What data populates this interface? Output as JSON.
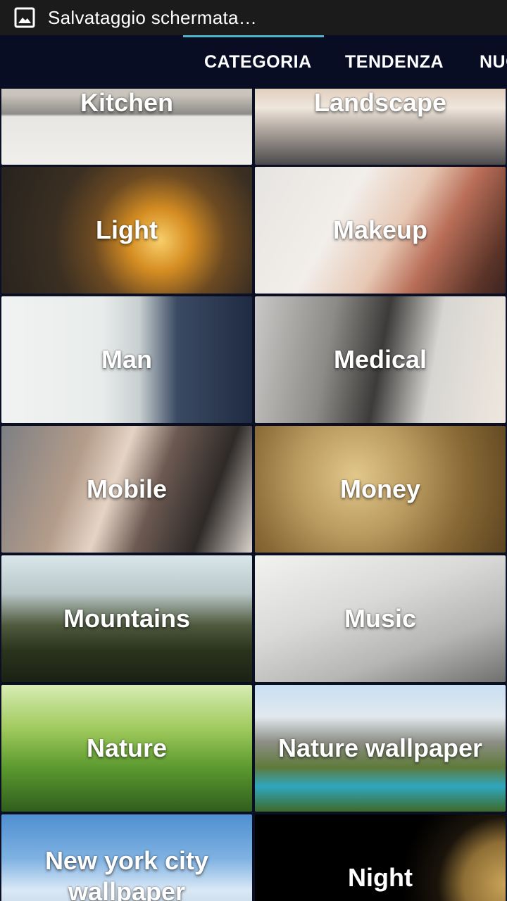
{
  "status_bar": {
    "notification_icon": "image-icon",
    "text": "Salvataggio schermata…"
  },
  "tabs": [
    {
      "label": "CATEGORIA",
      "selected": true
    },
    {
      "label": "TENDENZA",
      "selected": false
    },
    {
      "label": "NUOVI",
      "selected": false
    }
  ],
  "accent_color": "#4fb3c8",
  "categories": [
    {
      "label": "Kitchen"
    },
    {
      "label": "Landscape"
    },
    {
      "label": "Light"
    },
    {
      "label": "Makeup"
    },
    {
      "label": "Man"
    },
    {
      "label": "Medical"
    },
    {
      "label": "Mobile"
    },
    {
      "label": "Money"
    },
    {
      "label": "Mountains"
    },
    {
      "label": "Music"
    },
    {
      "label": "Nature"
    },
    {
      "label": "Nature wallpaper"
    },
    {
      "label": "New york city wallpaper"
    },
    {
      "label": "Night"
    }
  ]
}
